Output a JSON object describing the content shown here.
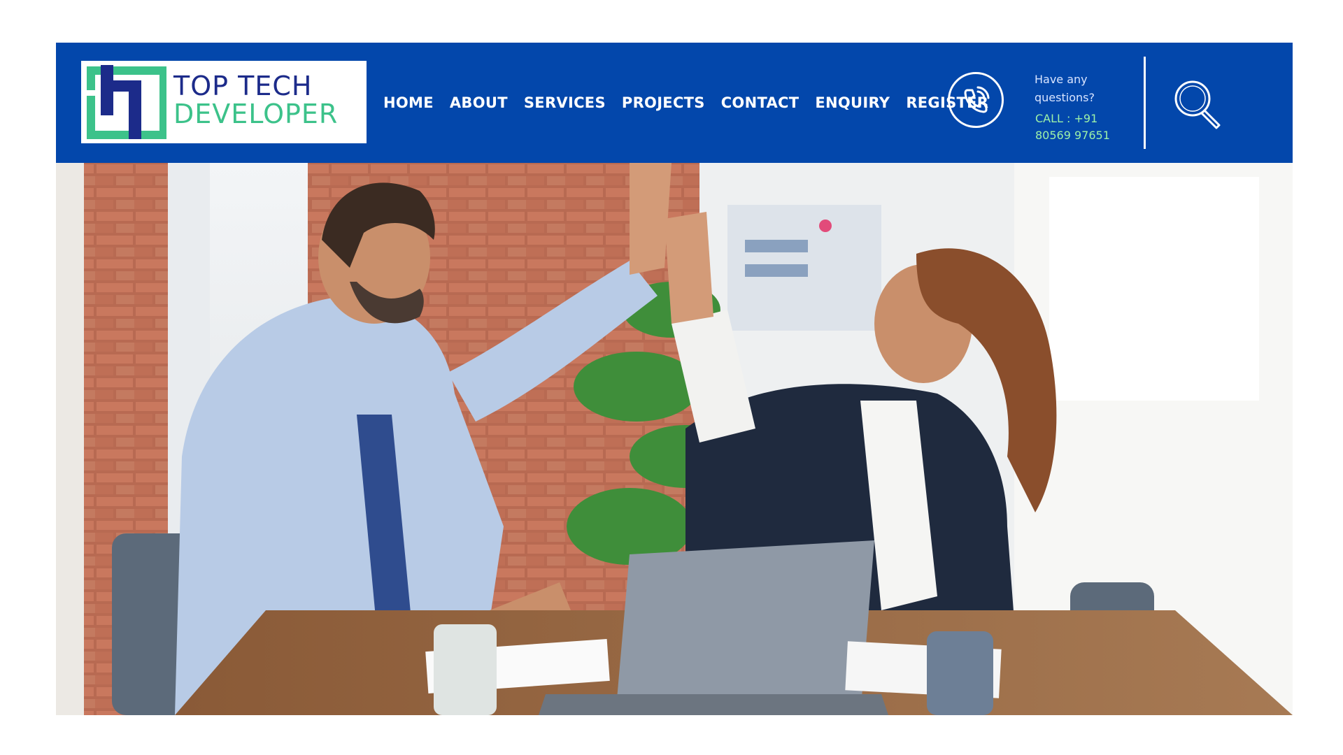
{
  "brand": {
    "name_line1": "TOP TECH",
    "name_line2": "DEVELOPER",
    "colors": {
      "navy": "#1c2b8a",
      "green": "#3cc28a"
    }
  },
  "header": {
    "background": "#0347ab"
  },
  "nav": {
    "items": [
      {
        "label": "HOME"
      },
      {
        "label": "ABOUT"
      },
      {
        "label": "SERVICES"
      },
      {
        "label": "PROJECTS"
      },
      {
        "label": "CONTACT"
      },
      {
        "label": "ENQUIRY"
      },
      {
        "label": "REGISTER"
      }
    ]
  },
  "contact": {
    "question": "Have any questions?",
    "call_label": "CALL :  +91",
    "call_number": "80569 97651",
    "icon": "phone-icon"
  },
  "search": {
    "icon": "search-icon"
  },
  "hero": {
    "image": "office-high-five-photo"
  }
}
